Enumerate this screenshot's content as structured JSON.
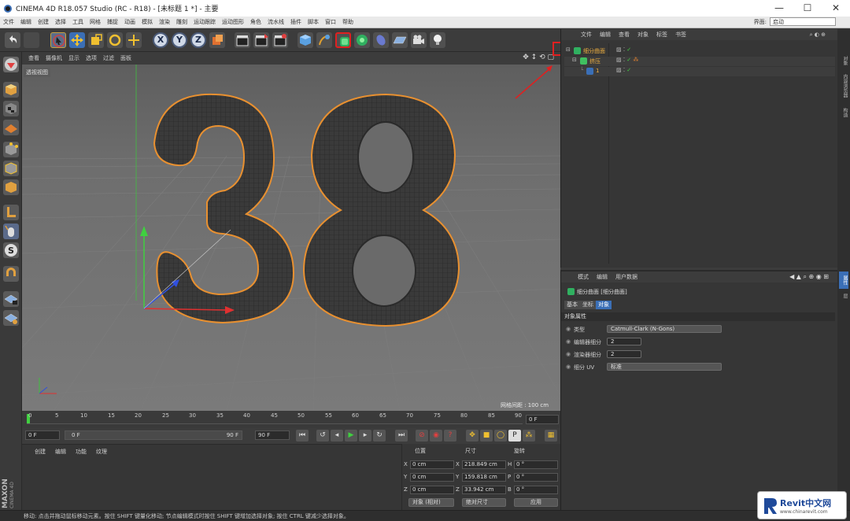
{
  "window": {
    "title": "CINEMA 4D R18.057 Studio (RC - R18) - [未标题 1 *] - 主要",
    "minimize": "—",
    "maximize": "☐",
    "close": "✕"
  },
  "menubar": {
    "items": [
      "文件",
      "编辑",
      "创建",
      "选择",
      "工具",
      "网格",
      "捕捉",
      "动画",
      "模拟",
      "渲染",
      "雕刻",
      "运动跟踪",
      "运动图形",
      "角色",
      "流水线",
      "插件",
      "脚本",
      "窗口",
      "帮助"
    ],
    "layout_label": "界面:",
    "layout_value": "启动"
  },
  "toolbar": {
    "axis_x": "X",
    "axis_y": "Y",
    "axis_z": "Z"
  },
  "viewport": {
    "menu": [
      "查看",
      "摄像机",
      "显示",
      "选项",
      "过滤",
      "面板"
    ],
    "view_label": "透视视图",
    "grid_label": "网格间距 : 100 cm",
    "model_text": "38"
  },
  "timeline": {
    "ticks": [
      "0",
      "5",
      "10",
      "15",
      "20",
      "25",
      "30",
      "35",
      "40",
      "45",
      "50",
      "55",
      "60",
      "65",
      "70",
      "75",
      "80",
      "85",
      "90"
    ],
    "current_frame": "0 F"
  },
  "transport": {
    "start": "0 F",
    "range_start": "0 F",
    "range_end": "90 F",
    "end": "90 F"
  },
  "material_manager": {
    "menu": [
      "创建",
      "编辑",
      "功能",
      "纹理"
    ]
  },
  "coordinates": {
    "headers": [
      "位置",
      "尺寸",
      "旋转"
    ],
    "rows": [
      {
        "axis": "X",
        "pos": "0 cm",
        "size_axis": "X",
        "size": "218.849 cm",
        "rot_axis": "H",
        "rot": "0 °"
      },
      {
        "axis": "Y",
        "pos": "0 cm",
        "size_axis": "Y",
        "size": "159.818 cm",
        "rot_axis": "P",
        "rot": "0 °"
      },
      {
        "axis": "Z",
        "pos": "0 cm",
        "size_axis": "Z",
        "size": "33.942 cm",
        "rot_axis": "B",
        "rot": "0 °"
      }
    ],
    "mode": "对象 (相对)",
    "size_mode": "绝对尺寸",
    "apply": "应用"
  },
  "object_manager": {
    "menu": [
      "文件",
      "编辑",
      "查看",
      "对象",
      "标签",
      "书签"
    ],
    "objects": [
      {
        "name": "细分曲面",
        "level": 0
      },
      {
        "name": "挤压",
        "level": 1
      },
      {
        "name": "1",
        "level": 2
      }
    ]
  },
  "attribute_manager": {
    "menu": [
      "模式",
      "编辑",
      "用户数据"
    ],
    "object_title": "细分曲面 [细分曲面]",
    "tabs": [
      "基本",
      "坐标",
      "对象"
    ],
    "active_tab": "对象",
    "section": "对象属性",
    "props": [
      {
        "label": "类型",
        "value": "Catmull-Clark (N-Gons)"
      },
      {
        "label": "编辑器细分",
        "value": "2"
      },
      {
        "label": "渲染器细分",
        "value": "2"
      },
      {
        "label": "细分 UV",
        "value": "标准"
      }
    ]
  },
  "right_tabs": [
    "对象",
    "内容浏览器",
    "构造",
    "属性",
    "层"
  ],
  "status": {
    "text": "移动: 点击并拖动鼠标移动元素。按住 SHIFT 键量化移动; 节点编辑模式时按住 SHIFT 键增加选择对象; 按住 CTRL 键减少选择对象。"
  },
  "maxon": {
    "brand": "MAXON",
    "product": "CINEMA 4D"
  },
  "watermark": {
    "brand": "Revit中文网",
    "url": "www.chinarevit.com"
  },
  "colors": {
    "accent": "#3b6fb6",
    "highlight_red": "#e02020",
    "selection_orange": "#e8a030"
  }
}
